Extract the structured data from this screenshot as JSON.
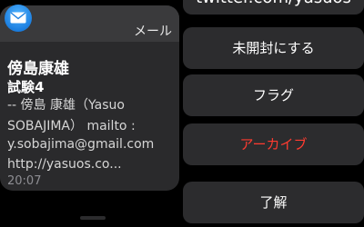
{
  "notification": {
    "app_name": "メール",
    "app_icon": "mail-envelope-icon",
    "sender": "傍島康雄",
    "subject": "試験4",
    "body_lines": [
      "-- 傍島 康雄（Yasuo",
      "SOBAJIMA） mailto :",
      "y.sobajima@gmail.com",
      "http://yasuos.co..."
    ],
    "time": "20:07"
  },
  "actions": {
    "partial_text": "twitter.com/yasuos",
    "mark_unread": "未開封にする",
    "flag": "フラグ",
    "archive": "アーカイブ",
    "dismiss": "了解"
  },
  "colors": {
    "archive_text": "#ff3b30",
    "icon_blue": "#1c7fe0"
  }
}
